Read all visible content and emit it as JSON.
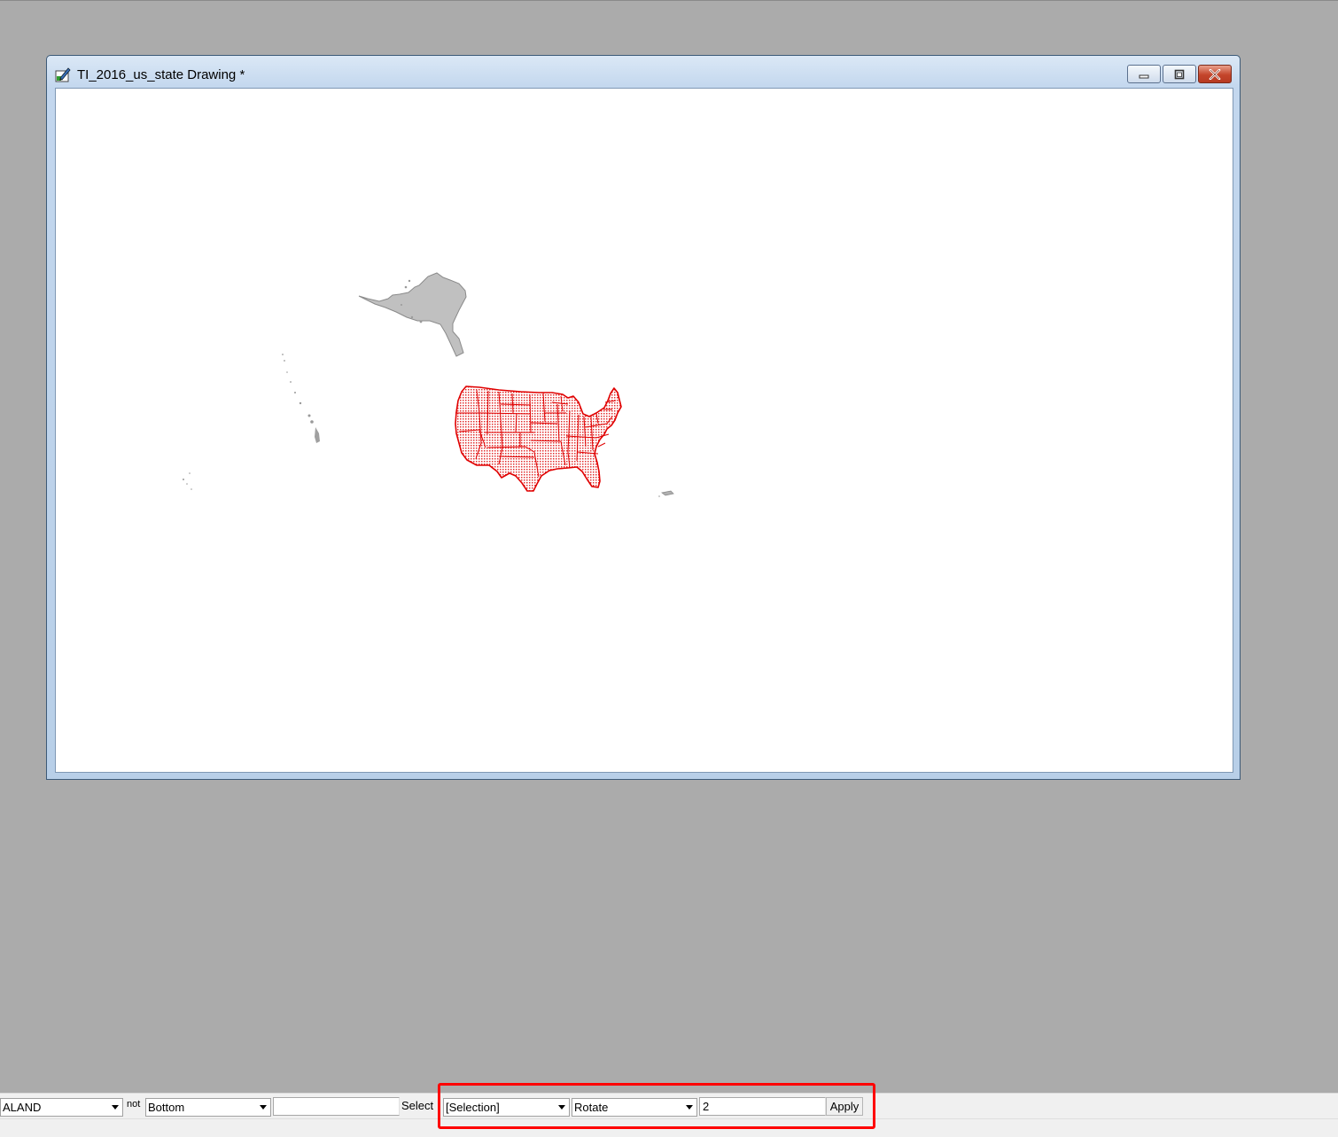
{
  "window": {
    "title": "TI_2016_us_state Drawing *",
    "icons": {
      "app": "drawing-app-icon",
      "minimize": "minimize-icon",
      "maximize": "maximize-icon",
      "close": "close-icon"
    }
  },
  "map": {
    "selected_color": "#ff0000",
    "unselected_color": "#c0c0c0",
    "selected_region": "contiguous-us-states",
    "unselected_regions": [
      "alaska",
      "hawaii",
      "puerto-rico",
      "pacific-islands"
    ]
  },
  "toolbar": {
    "field_combo": "ALAND",
    "not_label": "not",
    "position_combo": "Bottom",
    "value_input": "",
    "select_label": "Select",
    "target_combo": "[Selection]",
    "action_combo": "Rotate",
    "amount_input": "2",
    "apply_label": "Apply"
  },
  "colors": {
    "background": "#ababab",
    "highlight": "#ff0000"
  }
}
